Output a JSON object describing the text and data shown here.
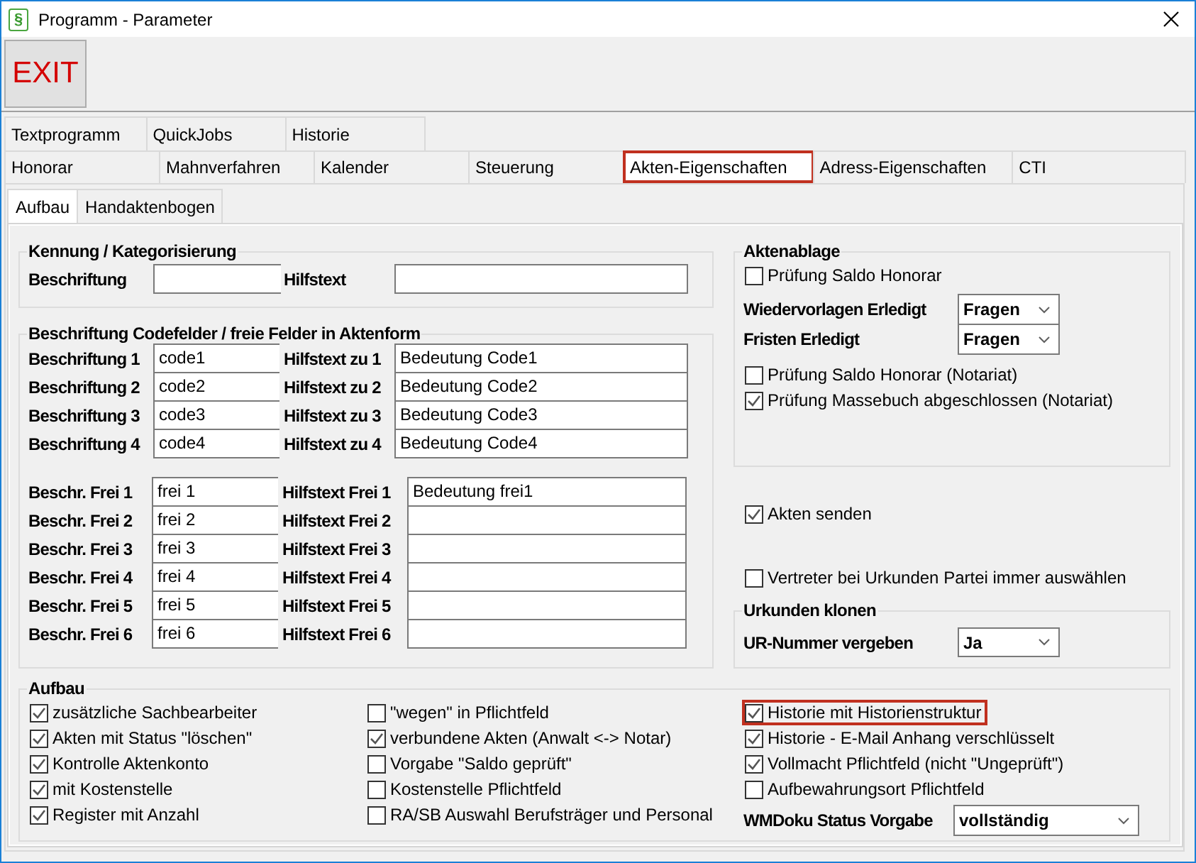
{
  "window": {
    "icon_glyph": "§",
    "title": "Programm - Parameter"
  },
  "toolbar": {
    "exit_label": "EXIT"
  },
  "tab_rows": [
    [
      {
        "label": "Textprogramm",
        "selected": false,
        "highlighted": false
      },
      {
        "label": "QuickJobs",
        "selected": false,
        "highlighted": false
      },
      {
        "label": "Historie",
        "selected": false,
        "highlighted": false
      }
    ],
    [
      {
        "label": "Honorar",
        "selected": false,
        "highlighted": false
      },
      {
        "label": "Mahnverfahren",
        "selected": false,
        "highlighted": false
      },
      {
        "label": "Kalender",
        "selected": false,
        "highlighted": false
      },
      {
        "label": "Steuerung",
        "selected": false,
        "highlighted": false
      },
      {
        "label": "Akten-Eigenschaften",
        "selected": true,
        "highlighted": true
      },
      {
        "label": "Adress-Eigenschaften",
        "selected": false,
        "highlighted": false
      },
      {
        "label": "CTI",
        "selected": false,
        "highlighted": false
      }
    ]
  ],
  "subtabs": [
    {
      "label": "Aufbau",
      "selected": true
    },
    {
      "label": "Handaktenbogen",
      "selected": false
    }
  ],
  "kennung": {
    "title": "Kennung / Kategorisierung",
    "fields": [
      {
        "label": "Beschriftung"
      },
      {
        "label": "Hilfstext"
      }
    ]
  },
  "codefelder": {
    "title": "Beschriftung Codefelder / freie Felder in Aktenform",
    "code_rows": [
      {
        "label": "Beschriftung 1",
        "value": "code1",
        "help_label": "Hilfstext zu 1",
        "help_value": "Bedeutung Code1"
      },
      {
        "label": "Beschriftung 2",
        "value": "code2",
        "help_label": "Hilfstext zu 2",
        "help_value": "Bedeutung Code2"
      },
      {
        "label": "Beschriftung 3",
        "value": "code3",
        "help_label": "Hilfstext zu 3",
        "help_value": "Bedeutung Code3"
      },
      {
        "label": "Beschriftung 4",
        "value": "code4",
        "help_label": "Hilfstext zu 4",
        "help_value": "Bedeutung Code4"
      }
    ],
    "free_rows": [
      {
        "label": "Beschr. Frei 1",
        "value": "frei 1",
        "help_label": "Hilfstext Frei 1",
        "help_value": "Bedeutung frei1"
      },
      {
        "label": "Beschr. Frei 2",
        "value": "frei 2",
        "help_label": "Hilfstext Frei 2"
      },
      {
        "label": "Beschr. Frei 3",
        "value": "frei 3",
        "help_label": "Hilfstext Frei 3"
      },
      {
        "label": "Beschr. Frei 4",
        "value": "frei 4",
        "help_label": "Hilfstext Frei 4"
      },
      {
        "label": "Beschr. Frei 5",
        "value": "frei 5",
        "help_label": "Hilfstext Frei 5"
      },
      {
        "label": "Beschr. Frei 6",
        "value": "frei 6",
        "help_label": "Hilfstext Frei 6"
      }
    ]
  },
  "aktenablage": {
    "title": "Aktenablage",
    "items": [
      {
        "kind": "checkbox",
        "label": "Prüfung Saldo Honorar",
        "checked": false
      },
      {
        "kind": "select",
        "label": "Wiedervorlagen Erledigt",
        "value": "Fragen"
      },
      {
        "kind": "select",
        "label": "Fristen Erledigt",
        "value": "Fragen"
      },
      {
        "kind": "checkbox",
        "label": "Prüfung Saldo Honorar (Notariat)",
        "checked": false
      },
      {
        "kind": "checkbox",
        "label": "Prüfung Massebuch abgeschlossen (Notariat)",
        "checked": true
      }
    ]
  },
  "extra_options": [
    {
      "label": "Akten senden",
      "checked": true
    },
    {
      "label": "Vertreter bei Urkunden Partei immer auswählen",
      "checked": false
    }
  ],
  "urkunden_klonen": {
    "title": "Urkunden klonen",
    "field": {
      "label": "UR-Nummer vergeben",
      "value": "Ja"
    }
  },
  "aufbau": {
    "title": "Aufbau",
    "columns": [
      [
        {
          "kind": "checkbox",
          "label": "zusätzliche Sachbearbeiter",
          "checked": true,
          "highlighted": false
        },
        {
          "kind": "checkbox",
          "label": "Akten mit Status \"löschen\"",
          "checked": true,
          "highlighted": false
        },
        {
          "kind": "checkbox",
          "label": "Kontrolle Aktenkonto",
          "checked": true,
          "highlighted": false
        },
        {
          "kind": "checkbox",
          "label": "mit Kostenstelle",
          "checked": true,
          "highlighted": false
        },
        {
          "kind": "checkbox",
          "label": "Register mit Anzahl",
          "checked": true,
          "highlighted": false
        }
      ],
      [
        {
          "kind": "checkbox",
          "label": "\"wegen\" in Pflichtfeld",
          "checked": false,
          "highlighted": false
        },
        {
          "kind": "checkbox",
          "label": "verbundene Akten (Anwalt <-> Notar)",
          "checked": true,
          "highlighted": false
        },
        {
          "kind": "checkbox",
          "label": "Vorgabe \"Saldo geprüft\"",
          "checked": false,
          "highlighted": false
        },
        {
          "kind": "checkbox",
          "label": "Kostenstelle Pflichtfeld",
          "checked": false,
          "highlighted": false
        },
        {
          "kind": "checkbox",
          "label": "RA/SB Auswahl Berufsträger und Personal",
          "checked": false,
          "highlighted": false
        }
      ],
      [
        {
          "kind": "checkbox",
          "label": "Historie mit Historienstruktur",
          "checked": true,
          "highlighted": true
        },
        {
          "kind": "checkbox",
          "label": "Historie - E-Mail Anhang verschlüsselt",
          "checked": true,
          "highlighted": false
        },
        {
          "kind": "checkbox",
          "label": "Vollmacht Pflichtfeld (nicht \"Ungeprüft\")",
          "checked": true,
          "highlighted": false
        },
        {
          "kind": "checkbox",
          "label": "Aufbewahrungsort Pflichtfeld",
          "checked": false,
          "highlighted": false
        },
        {
          "kind": "select",
          "label": "WMDoku Status Vorgabe",
          "value": "vollständig"
        }
      ]
    ]
  }
}
